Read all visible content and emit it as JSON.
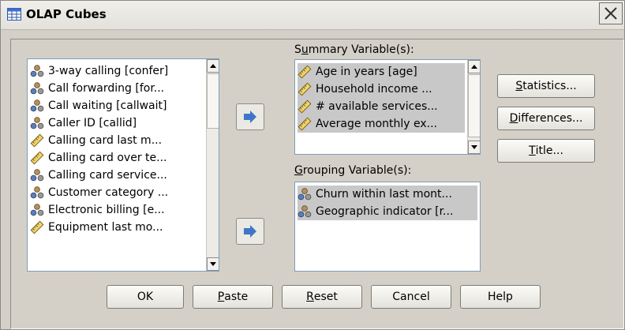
{
  "window": {
    "title": "OLAP Cubes",
    "icon": "table-grid-icon"
  },
  "source_list": {
    "items": [
      {
        "label": "3-way calling [confer]",
        "icon": "nominal-variable-icon"
      },
      {
        "label": "Call forwarding [for...",
        "icon": "nominal-variable-icon"
      },
      {
        "label": "Call waiting [callwait]",
        "icon": "nominal-variable-icon"
      },
      {
        "label": "Caller ID [callid]",
        "icon": "nominal-variable-icon"
      },
      {
        "label": "Calling card last m...",
        "icon": "scale-variable-icon"
      },
      {
        "label": "Calling card over te...",
        "icon": "scale-variable-icon"
      },
      {
        "label": "Calling card service...",
        "icon": "nominal-variable-icon"
      },
      {
        "label": "Customer category ...",
        "icon": "nominal-variable-icon"
      },
      {
        "label": "Electronic billing [e...",
        "icon": "nominal-variable-icon"
      },
      {
        "label": "Equipment last mo...",
        "icon": "scale-variable-icon"
      }
    ]
  },
  "summary": {
    "label_pre": "S",
    "label_ul": "u",
    "label_post": "mmary Variable(s):",
    "items": [
      {
        "label": "Age in years [age]",
        "icon": "scale-variable-icon"
      },
      {
        "label": "Household income ...",
        "icon": "scale-variable-icon"
      },
      {
        "label": "# available services...",
        "icon": "scale-variable-icon"
      },
      {
        "label": "Average monthly ex...",
        "icon": "scale-variable-icon"
      }
    ]
  },
  "grouping": {
    "label_ul": "G",
    "label_post": "rouping Variable(s):",
    "items": [
      {
        "label": "Churn within last mont...",
        "icon": "nominal-variable-icon"
      },
      {
        "label": "Geographic indicator [r...",
        "icon": "nominal-variable-icon"
      }
    ]
  },
  "side_buttons": {
    "statistics": {
      "ul": "S",
      "rest": "tatistics..."
    },
    "differences": {
      "ul": "D",
      "rest": "ifferences..."
    },
    "title": {
      "ul": "T",
      "rest": "itle..."
    }
  },
  "bottom_buttons": {
    "ok": "OK",
    "paste": {
      "ul": "P",
      "rest": "aste"
    },
    "reset": {
      "ul": "R",
      "rest": "eset"
    },
    "cancel": "Cancel",
    "help": "Help"
  },
  "colors": {
    "dialog_bg": "#d4d0c8",
    "selection": "#c8c8c8",
    "arrow_blue": "#3f77c8"
  }
}
